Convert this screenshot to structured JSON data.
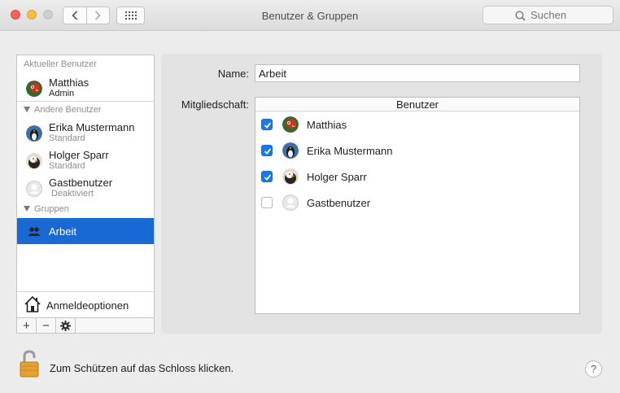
{
  "window": {
    "title": "Benutzer & Gruppen"
  },
  "search": {
    "placeholder": "Suchen"
  },
  "sidebar": {
    "current_header": "Aktueller Benutzer",
    "current_user": {
      "name": "Matthias",
      "role": "Admin"
    },
    "other_header": "Andere Benutzer",
    "other_users": [
      {
        "name": "Erika Mustermann",
        "role": "Standard"
      },
      {
        "name": "Holger Sparr",
        "role": "Standard"
      },
      {
        "name": "Gastbenutzer",
        "role": "Deaktiviert"
      }
    ],
    "groups_header": "Gruppen",
    "groups": [
      {
        "name": "Arbeit"
      }
    ],
    "login_options": "Anmeldeoptionen",
    "add_label": "+",
    "remove_label": "−"
  },
  "detail": {
    "name_label": "Name:",
    "name_value": "Arbeit",
    "membership_label": "Mitgliedschaft:",
    "members_header": "Benutzer",
    "members": [
      {
        "name": "Matthias",
        "checked": true
      },
      {
        "name": "Erika Mustermann",
        "checked": true
      },
      {
        "name": "Holger Sparr",
        "checked": true
      },
      {
        "name": "Gastbenutzer",
        "checked": false
      }
    ]
  },
  "footer": {
    "lock_text": "Zum Schützen auf das Schloss klicken.",
    "help_label": "?"
  },
  "colors": {
    "accent": "#1769d6",
    "checkbox": "#1778f2"
  }
}
